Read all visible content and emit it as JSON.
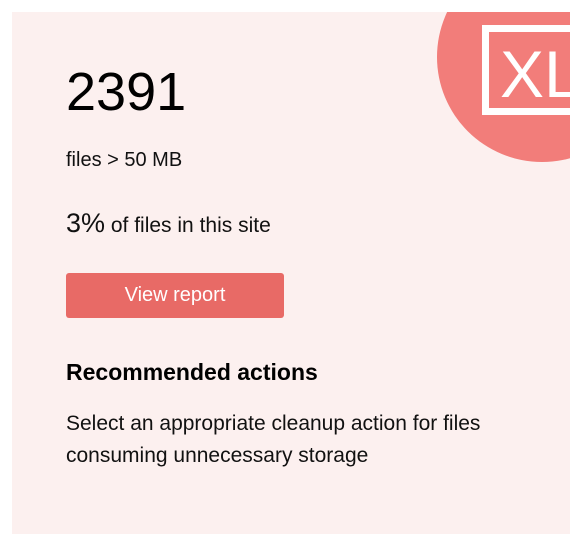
{
  "stat": {
    "count": "2391",
    "subtitle": "files > 50 MB",
    "percent": "3%",
    "percent_text": " of files in this site"
  },
  "actions": {
    "view_report_label": "View report"
  },
  "recommended": {
    "title": "Recommended actions",
    "description": "Select an appropriate cleanup action for files consuming unnecessary storage"
  },
  "icon": {
    "name": "xl-file-icon",
    "letters": "XL"
  },
  "colors": {
    "card_background": "#fcf0ef",
    "badge": "#f27d7a",
    "button": "#e86a66",
    "button_text": "#ffffff"
  }
}
